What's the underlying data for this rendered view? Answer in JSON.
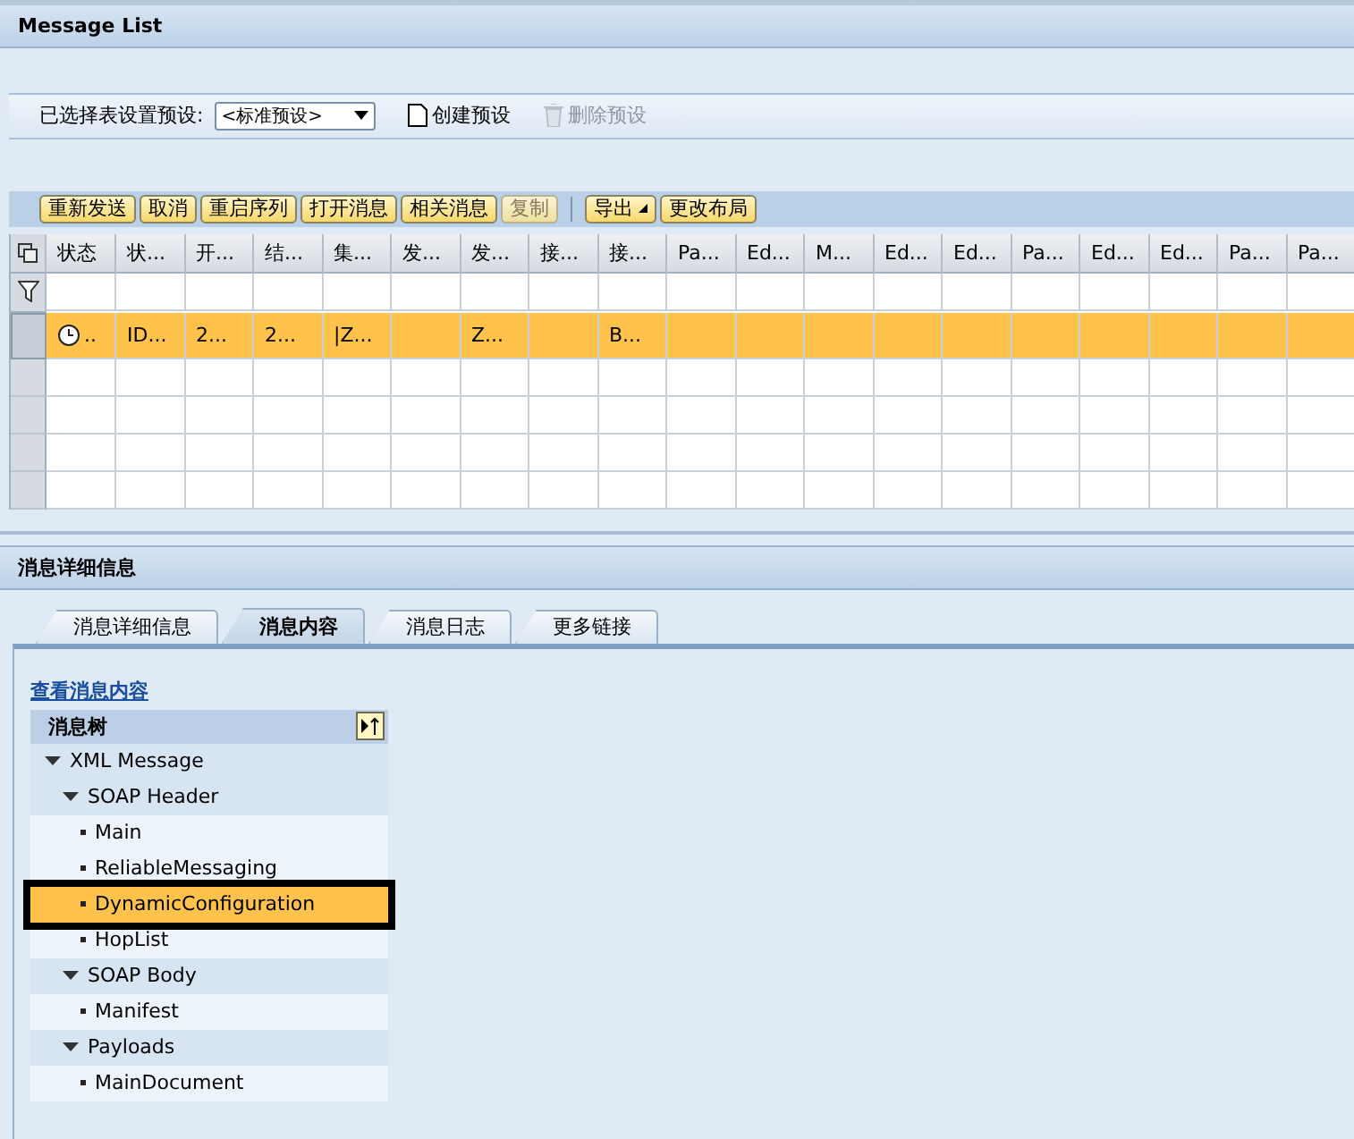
{
  "list_panel": {
    "title": "Message List"
  },
  "variant_bar": {
    "label": "已选择表设置预设:",
    "dropdown_value": "<标准预设>",
    "actions": [
      {
        "label": "创建预设",
        "kind": "create",
        "disabled": false
      },
      {
        "label": "删除预设",
        "kind": "delete",
        "disabled": true
      }
    ]
  },
  "table_toolbar": [
    {
      "label": "重新发送",
      "disabled": false,
      "kind": "button"
    },
    {
      "label": "取消",
      "disabled": false,
      "kind": "button"
    },
    {
      "label": "重启序列",
      "disabled": false,
      "kind": "button"
    },
    {
      "label": "打开消息",
      "disabled": false,
      "kind": "button"
    },
    {
      "label": "相关消息",
      "disabled": false,
      "kind": "button"
    },
    {
      "label": "复制",
      "disabled": true,
      "kind": "button"
    },
    {
      "label": "导出",
      "disabled": false,
      "kind": "menu"
    },
    {
      "label": "更改布局",
      "disabled": false,
      "kind": "button"
    }
  ],
  "table": {
    "columns": [
      "状态",
      "状...",
      "开...",
      "结...",
      "集...",
      "发...",
      "发...",
      "接...",
      "接...",
      "Pa...",
      "Ed...",
      "M...",
      "Ed...",
      "Ed...",
      "Pa...",
      "Ed...",
      "Ed...",
      "Pa...",
      "Pa..."
    ],
    "rows": [
      {
        "selected": true,
        "cells": [
          "..",
          "ID...",
          "2...",
          "2...",
          "|Z...",
          null,
          "Z...",
          null,
          "B..."
        ]
      }
    ]
  },
  "detail_panel": {
    "title": "消息详细信息"
  },
  "tabs": [
    {
      "label": "消息详细信息",
      "selected": false
    },
    {
      "label": "消息内容",
      "selected": true
    },
    {
      "label": "消息日志",
      "selected": false
    },
    {
      "label": "更多链接",
      "selected": false
    }
  ],
  "content": {
    "link": "查看消息内容",
    "tree_title": "消息树",
    "tree": [
      {
        "label": "XML Message",
        "expanded": true,
        "children": [
          {
            "label": "SOAP Header",
            "expanded": true,
            "children": [
              {
                "label": "Main",
                "selected": false
              },
              {
                "label": "ReliableMessaging",
                "selected": false
              },
              {
                "label": "DynamicConfiguration",
                "selected": true
              },
              {
                "label": "HopList",
                "selected": false
              }
            ]
          },
          {
            "label": "SOAP Body",
            "expanded": true,
            "children": [
              {
                "label": "Manifest",
                "selected": false
              }
            ]
          },
          {
            "label": "Payloads",
            "expanded": true,
            "children": [
              {
                "label": "MainDocument",
                "selected": false
              }
            ]
          }
        ]
      }
    ]
  }
}
